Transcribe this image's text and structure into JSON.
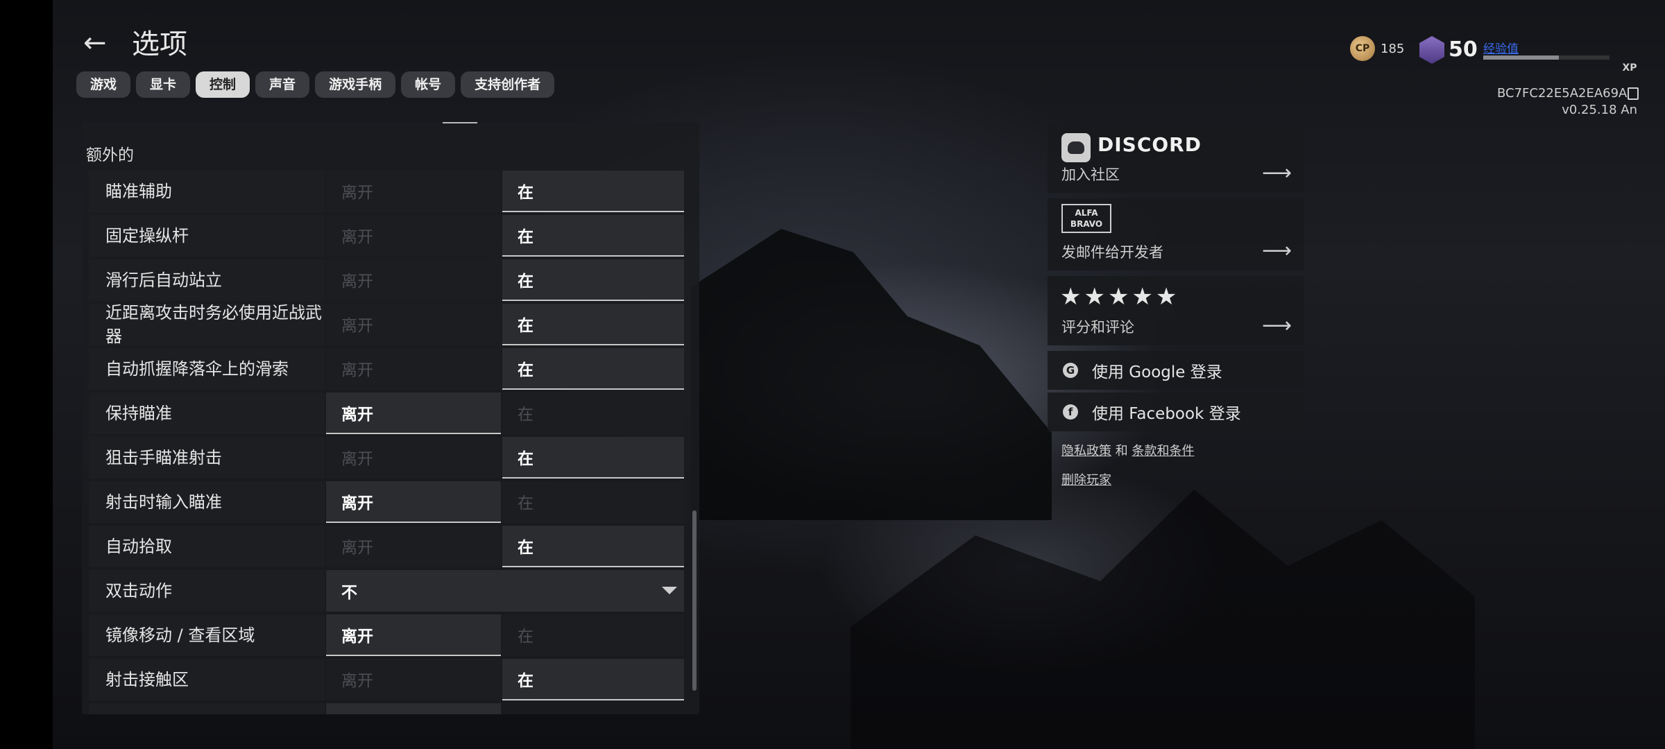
{
  "header": {
    "back_icon": "←",
    "title": "选项",
    "tabs": [
      {
        "label": "游戏"
      },
      {
        "label": "显卡"
      },
      {
        "label": "控制",
        "active": true
      },
      {
        "label": "声音"
      },
      {
        "label": "游戏手柄"
      },
      {
        "label": "帐号"
      },
      {
        "label": "支持创作者"
      }
    ]
  },
  "section_title": "额外的",
  "option_labels": {
    "off": "离开",
    "on": "在"
  },
  "rows": [
    {
      "label": "瞄准辅助",
      "value": "on"
    },
    {
      "label": "固定操纵杆",
      "value": "on"
    },
    {
      "label": "滑行后自动站立",
      "value": "on"
    },
    {
      "label": "近距离攻击时务必使用近战武器",
      "value": "on"
    },
    {
      "label": "自动抓握降落伞上的滑索",
      "value": "on"
    },
    {
      "label": "保持瞄准",
      "value": "off"
    },
    {
      "label": "狙击手瞄准射击",
      "value": "on"
    },
    {
      "label": "射击时输入瞄准",
      "value": "off"
    },
    {
      "label": "自动拾取",
      "value": "on"
    },
    {
      "label": "双击动作",
      "type": "dropdown",
      "selected": "不"
    },
    {
      "label": "镜像移动 / 查看区域",
      "value": "off"
    },
    {
      "label": "射击接触区",
      "value": "on"
    }
  ],
  "profile": {
    "cp_icon_text": "CP",
    "cp_value": "185",
    "level": "50",
    "xp_label": "经验值",
    "xp_progress": 0.6,
    "xp_badge": "XP",
    "player_id": "BC7FC22E5A2EA69A",
    "version": "v0.25.18 An"
  },
  "social": {
    "discord_word": "DISCORD",
    "discord_sub": "加入社区",
    "alfa_line1": "ALFA",
    "alfa_line2": "BRAVO",
    "alfa_sub": "发邮件给开发者",
    "stars": "★★★★★",
    "rate_sub": "评分和评论",
    "arrow": "⟶",
    "google_icon": "G",
    "google_login": "使用 Google 登录",
    "facebook_icon": "f",
    "facebook_login": "使用 Facebook 登录",
    "privacy": "隐私政策",
    "and": "和",
    "terms": "条款和条件",
    "delete_player": "删除玩家"
  },
  "colors": {
    "accent_link": "#3a6cf0",
    "selected_underline": "#c8c8c8"
  }
}
